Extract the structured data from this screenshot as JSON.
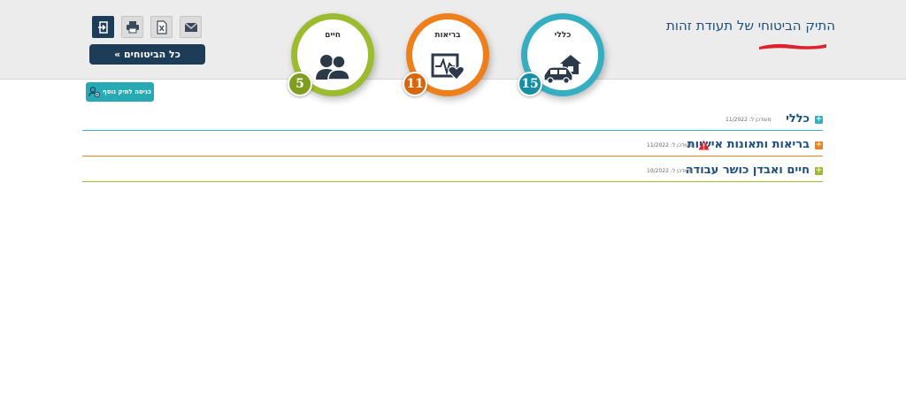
{
  "header": {
    "title": "התיק הביטוחי של תעודת זהות"
  },
  "toolbar": {
    "all_insurances_label": "כל הביטוחים »",
    "add_file_label": "כניסה לתיק נוסף"
  },
  "categories": [
    {
      "label": "כללי",
      "count": "15"
    },
    {
      "label": "בריאות",
      "count": "11"
    },
    {
      "label": "חיים",
      "count": "5"
    }
  ],
  "sections": [
    {
      "title": "כללי",
      "updated": "מעודכן ל: 11/2022"
    },
    {
      "title": "בריאות ותאונות אישיות",
      "updated": "מעודכן ל: 11/2022"
    },
    {
      "title": "חיים ואבדן כושר עבודה",
      "updated": "מעודכן ל: 10/2022"
    }
  ],
  "colors": {
    "general": "#35aec1",
    "health": "#ef7f1a",
    "life": "#9dbb2f",
    "navy": "#1d3c58",
    "title_blue": "#1f4f7b",
    "redaction": "#e0202a"
  },
  "icons": [
    "logout-icon",
    "print-icon",
    "excel-icon",
    "email-icon",
    "car-house-icon",
    "health-monitor-icon",
    "family-icon",
    "add-user-icon",
    "warning-icon",
    "plus-icon"
  ]
}
